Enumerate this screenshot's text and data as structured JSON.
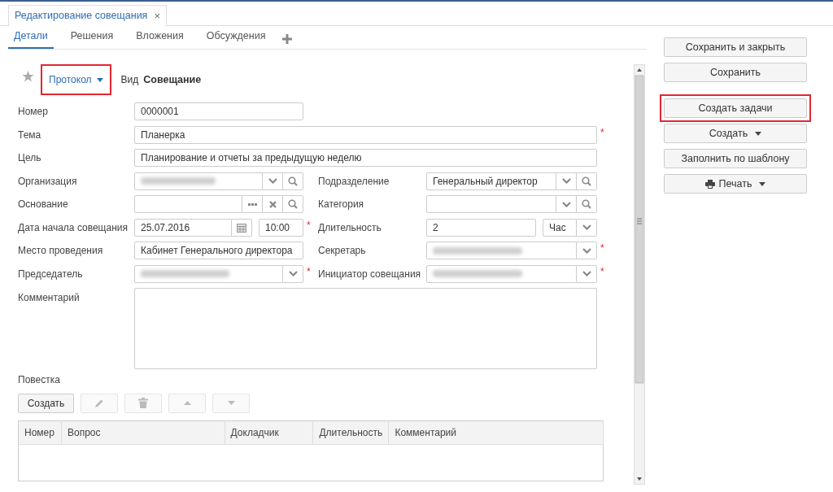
{
  "window": {
    "tab": {
      "title": "Редактирование совещания",
      "close": "×",
      "selected": true
    }
  },
  "subtabs": [
    {
      "label": "Детали",
      "selected": true
    },
    {
      "label": "Решения",
      "selected": false
    },
    {
      "label": "Вложения",
      "selected": false
    },
    {
      "label": "Обсуждения",
      "selected": false
    }
  ],
  "header": {
    "template": {
      "label": "Протокол",
      "highlighted": true
    },
    "kind_label": "Вид",
    "kind_value": "Совещание"
  },
  "form": {
    "rows": [
      {
        "left": {
          "label": "Номер",
          "kind": "text",
          "value": "0000001"
        }
      },
      {
        "full": {
          "label": "Тема",
          "kind": "text",
          "value": "Планерка",
          "required_mark": "*"
        }
      },
      {
        "full": {
          "label": "Цель",
          "kind": "text",
          "value": "Планирование и отчеты за предыдущую неделю"
        }
      },
      {
        "left": {
          "label": "Организация",
          "kind": "lookup",
          "blurred": true,
          "addons": [
            {
              "kind": "dropdown"
            },
            {
              "kind": "search"
            }
          ]
        },
        "right": {
          "label": "Подразделение",
          "kind": "lookup",
          "blurred": false,
          "value": "Генеральный директор",
          "addons": [
            {
              "kind": "dropdown"
            },
            {
              "kind": "search"
            }
          ]
        }
      },
      {
        "left": {
          "label": "Основание",
          "kind": "lookup",
          "blurred": false,
          "addons": [
            {
              "kind": "more"
            },
            {
              "kind": "clear"
            },
            {
              "kind": "search"
            }
          ]
        },
        "right": {
          "label": "Категория",
          "kind": "lookup",
          "blurred": false,
          "addons": [
            {
              "kind": "dropdown"
            },
            {
              "kind": "search"
            }
          ]
        }
      },
      {
        "left": {
          "label": "Дата начала совещания",
          "kind": "datetime",
          "value": "25.07.2016",
          "time": "10:00",
          "required_mark": "*"
        },
        "right": {
          "label": "Длительность",
          "kind": "duration",
          "value": "2",
          "unit": "Час"
        }
      },
      {
        "left": {
          "label": "Место проведения",
          "kind": "text",
          "value": "Кабинет Генерального директора"
        },
        "right": {
          "label": "Секретарь",
          "kind": "lookup",
          "blurred": true,
          "addons": [
            {
              "kind": "dropdown"
            }
          ],
          "required_mark": "*"
        }
      },
      {
        "left": {
          "label": "Председатель",
          "kind": "lookup",
          "blurred": true,
          "addons": [
            {
              "kind": "dropdown"
            }
          ],
          "required_mark": "*"
        },
        "right": {
          "label": "Инициатор совещания",
          "kind": "lookup",
          "blurred": true,
          "addons": [
            {
              "kind": "dropdown"
            }
          ],
          "required_mark": "*"
        }
      },
      {
        "full": {
          "label": "Комментарий",
          "kind": "textarea"
        }
      }
    ]
  },
  "agenda": {
    "title": "Повестка",
    "toolbar": [
      {
        "kind": "text",
        "label": "Создать",
        "disabled": false
      },
      {
        "kind": "edit",
        "disabled": true
      },
      {
        "kind": "delete",
        "disabled": true
      },
      {
        "kind": "up",
        "disabled": true
      },
      {
        "kind": "down",
        "disabled": true
      }
    ],
    "columns": [
      "Номер",
      "Вопрос",
      "Докладчик",
      "Длительность",
      "Комментарий"
    ]
  },
  "action_groups": [
    [
      {
        "label": "Сохранить и закрыть",
        "highlighted": false,
        "kind": "plain"
      },
      {
        "label": "Сохранить",
        "highlighted": false,
        "kind": "plain"
      }
    ],
    [
      {
        "label": "Создать задачи",
        "highlighted": true,
        "kind": "plain"
      },
      {
        "label": "Создать",
        "highlighted": false,
        "kind": "menu"
      },
      {
        "label": "Заполнить по шаблону",
        "highlighted": false,
        "kind": "plain"
      },
      {
        "label": "Печать",
        "highlighted": false,
        "kind": "print-menu"
      }
    ]
  ]
}
